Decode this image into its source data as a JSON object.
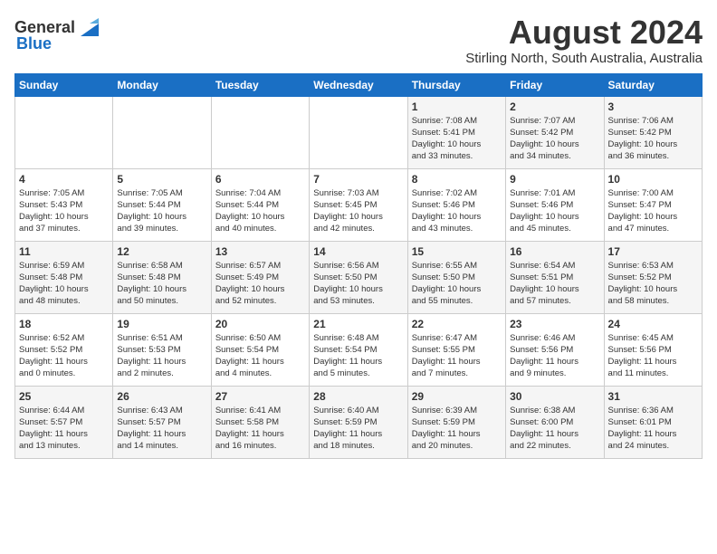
{
  "header": {
    "logo_general": "General",
    "logo_blue": "Blue",
    "title": "August 2024",
    "subtitle": "Stirling North, South Australia, Australia"
  },
  "calendar": {
    "days_of_week": [
      "Sunday",
      "Monday",
      "Tuesday",
      "Wednesday",
      "Thursday",
      "Friday",
      "Saturday"
    ],
    "weeks": [
      [
        {
          "day": "",
          "info": ""
        },
        {
          "day": "",
          "info": ""
        },
        {
          "day": "",
          "info": ""
        },
        {
          "day": "",
          "info": ""
        },
        {
          "day": "1",
          "info": "Sunrise: 7:08 AM\nSunset: 5:41 PM\nDaylight: 10 hours\nand 33 minutes."
        },
        {
          "day": "2",
          "info": "Sunrise: 7:07 AM\nSunset: 5:42 PM\nDaylight: 10 hours\nand 34 minutes."
        },
        {
          "day": "3",
          "info": "Sunrise: 7:06 AM\nSunset: 5:42 PM\nDaylight: 10 hours\nand 36 minutes."
        }
      ],
      [
        {
          "day": "4",
          "info": "Sunrise: 7:05 AM\nSunset: 5:43 PM\nDaylight: 10 hours\nand 37 minutes."
        },
        {
          "day": "5",
          "info": "Sunrise: 7:05 AM\nSunset: 5:44 PM\nDaylight: 10 hours\nand 39 minutes."
        },
        {
          "day": "6",
          "info": "Sunrise: 7:04 AM\nSunset: 5:44 PM\nDaylight: 10 hours\nand 40 minutes."
        },
        {
          "day": "7",
          "info": "Sunrise: 7:03 AM\nSunset: 5:45 PM\nDaylight: 10 hours\nand 42 minutes."
        },
        {
          "day": "8",
          "info": "Sunrise: 7:02 AM\nSunset: 5:46 PM\nDaylight: 10 hours\nand 43 minutes."
        },
        {
          "day": "9",
          "info": "Sunrise: 7:01 AM\nSunset: 5:46 PM\nDaylight: 10 hours\nand 45 minutes."
        },
        {
          "day": "10",
          "info": "Sunrise: 7:00 AM\nSunset: 5:47 PM\nDaylight: 10 hours\nand 47 minutes."
        }
      ],
      [
        {
          "day": "11",
          "info": "Sunrise: 6:59 AM\nSunset: 5:48 PM\nDaylight: 10 hours\nand 48 minutes."
        },
        {
          "day": "12",
          "info": "Sunrise: 6:58 AM\nSunset: 5:48 PM\nDaylight: 10 hours\nand 50 minutes."
        },
        {
          "day": "13",
          "info": "Sunrise: 6:57 AM\nSunset: 5:49 PM\nDaylight: 10 hours\nand 52 minutes."
        },
        {
          "day": "14",
          "info": "Sunrise: 6:56 AM\nSunset: 5:50 PM\nDaylight: 10 hours\nand 53 minutes."
        },
        {
          "day": "15",
          "info": "Sunrise: 6:55 AM\nSunset: 5:50 PM\nDaylight: 10 hours\nand 55 minutes."
        },
        {
          "day": "16",
          "info": "Sunrise: 6:54 AM\nSunset: 5:51 PM\nDaylight: 10 hours\nand 57 minutes."
        },
        {
          "day": "17",
          "info": "Sunrise: 6:53 AM\nSunset: 5:52 PM\nDaylight: 10 hours\nand 58 minutes."
        }
      ],
      [
        {
          "day": "18",
          "info": "Sunrise: 6:52 AM\nSunset: 5:52 PM\nDaylight: 11 hours\nand 0 minutes."
        },
        {
          "day": "19",
          "info": "Sunrise: 6:51 AM\nSunset: 5:53 PM\nDaylight: 11 hours\nand 2 minutes."
        },
        {
          "day": "20",
          "info": "Sunrise: 6:50 AM\nSunset: 5:54 PM\nDaylight: 11 hours\nand 4 minutes."
        },
        {
          "day": "21",
          "info": "Sunrise: 6:48 AM\nSunset: 5:54 PM\nDaylight: 11 hours\nand 5 minutes."
        },
        {
          "day": "22",
          "info": "Sunrise: 6:47 AM\nSunset: 5:55 PM\nDaylight: 11 hours\nand 7 minutes."
        },
        {
          "day": "23",
          "info": "Sunrise: 6:46 AM\nSunset: 5:56 PM\nDaylight: 11 hours\nand 9 minutes."
        },
        {
          "day": "24",
          "info": "Sunrise: 6:45 AM\nSunset: 5:56 PM\nDaylight: 11 hours\nand 11 minutes."
        }
      ],
      [
        {
          "day": "25",
          "info": "Sunrise: 6:44 AM\nSunset: 5:57 PM\nDaylight: 11 hours\nand 13 minutes."
        },
        {
          "day": "26",
          "info": "Sunrise: 6:43 AM\nSunset: 5:57 PM\nDaylight: 11 hours\nand 14 minutes."
        },
        {
          "day": "27",
          "info": "Sunrise: 6:41 AM\nSunset: 5:58 PM\nDaylight: 11 hours\nand 16 minutes."
        },
        {
          "day": "28",
          "info": "Sunrise: 6:40 AM\nSunset: 5:59 PM\nDaylight: 11 hours\nand 18 minutes."
        },
        {
          "day": "29",
          "info": "Sunrise: 6:39 AM\nSunset: 5:59 PM\nDaylight: 11 hours\nand 20 minutes."
        },
        {
          "day": "30",
          "info": "Sunrise: 6:38 AM\nSunset: 6:00 PM\nDaylight: 11 hours\nand 22 minutes."
        },
        {
          "day": "31",
          "info": "Sunrise: 6:36 AM\nSunset: 6:01 PM\nDaylight: 11 hours\nand 24 minutes."
        }
      ]
    ]
  }
}
